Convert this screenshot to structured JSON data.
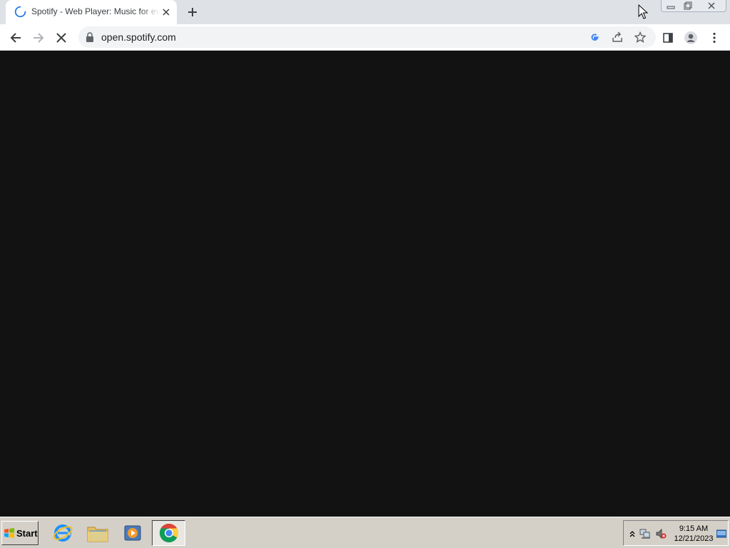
{
  "browser": {
    "tab": {
      "title": "Spotify - Web Player: Music for everyone",
      "loading": true
    },
    "address_bar": {
      "url": "open.spotify.com"
    },
    "icons": {
      "tab_spinner": "loading-spinner-icon",
      "tab_close": "close-icon",
      "new_tab": "plus-icon",
      "back": "back-arrow-icon",
      "forward": "forward-arrow-icon",
      "stop": "stop-icon",
      "lock": "lock-icon",
      "google": "google-icon",
      "share": "share-icon",
      "bookmark": "star-icon",
      "side_panel": "side-panel-icon",
      "profile": "profile-icon",
      "menu": "kebab-menu-icon",
      "minimize": "minimize-icon",
      "restore": "restore-icon",
      "close_window": "close-window-icon"
    },
    "page_background": "#121212"
  },
  "taskbar": {
    "start_label": "Start",
    "apps": [
      {
        "name": "internet-explorer",
        "icon": "ie-icon"
      },
      {
        "name": "file-explorer",
        "icon": "folder-icon"
      },
      {
        "name": "media-player",
        "icon": "media-player-icon"
      },
      {
        "name": "chrome",
        "icon": "chrome-icon",
        "active": true
      }
    ],
    "tray": {
      "time": "9:15 AM",
      "date": "12/21/2023",
      "icons": [
        "show-hidden-icons-icon",
        "network-icon",
        "volume-muted-icon",
        "show-desktop-icon"
      ]
    }
  }
}
